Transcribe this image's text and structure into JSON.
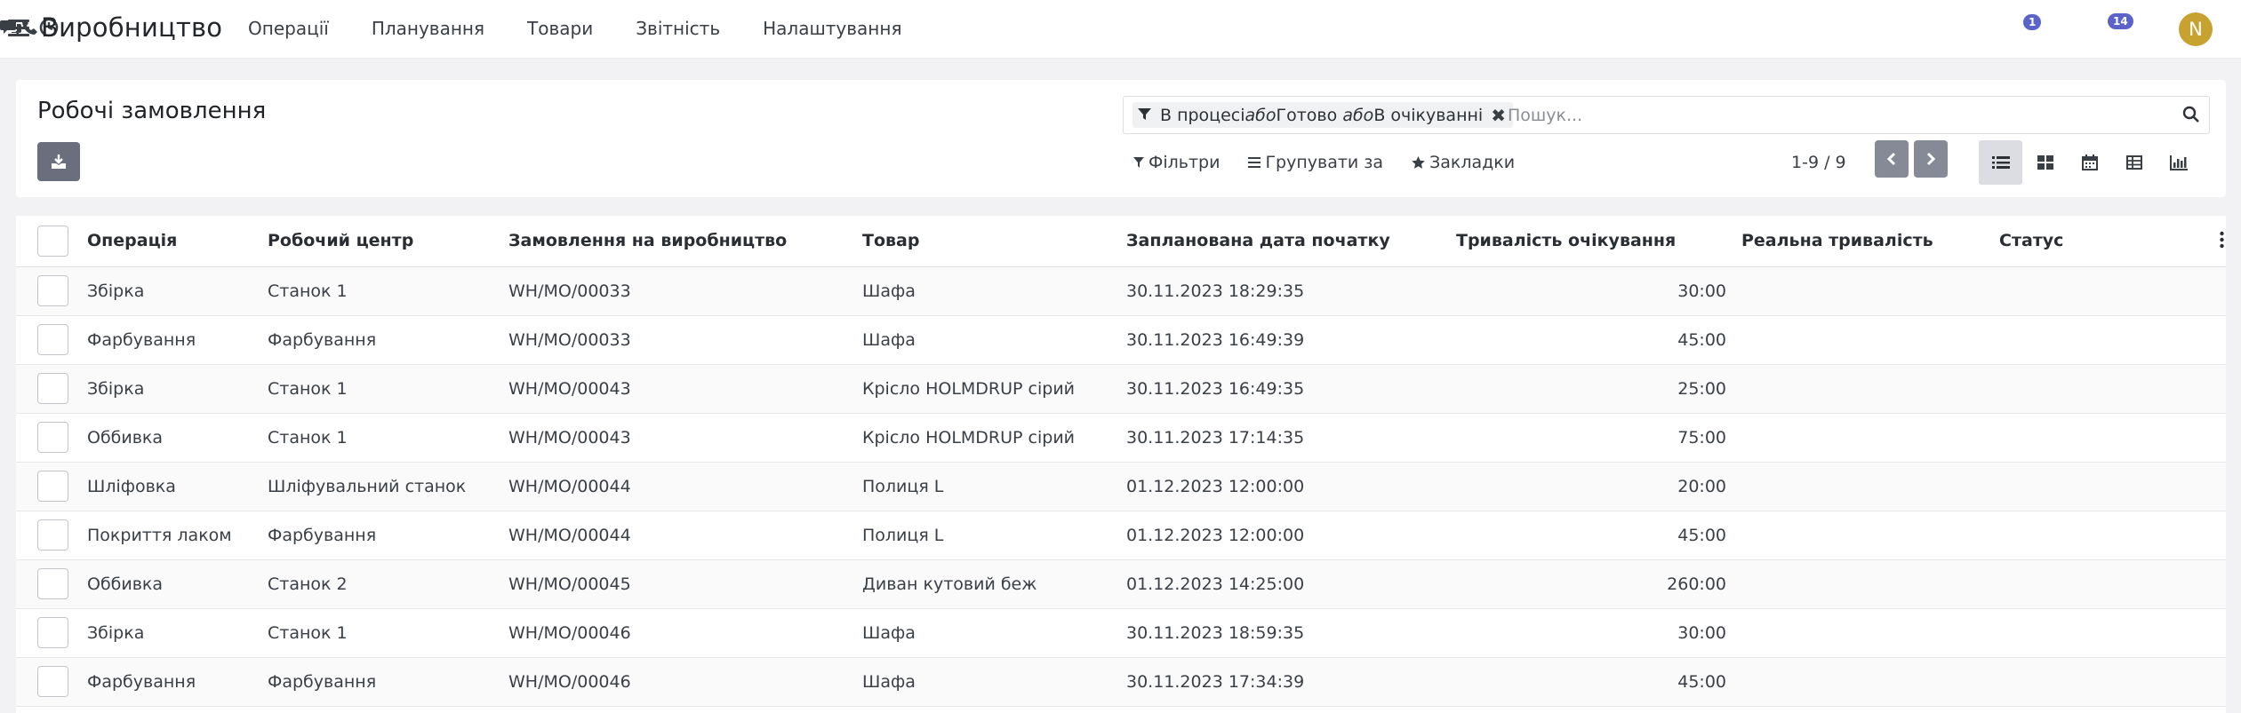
{
  "app": {
    "title": "Виробництво",
    "menu": [
      "Операції",
      "Планування",
      "Товари",
      "Звітність",
      "Налаштування"
    ]
  },
  "systray": {
    "messages_badge": "1",
    "activities_badge": "14",
    "avatar_letter": "N",
    "avatar_color": "#c8a230",
    "accent": "#5b63c9"
  },
  "breadcrumb": "Робочі замовлення",
  "search": {
    "facet_part1": "В процесі ",
    "facet_or1": "або",
    "facet_part2": " Готово ",
    "facet_or2": "або",
    "facet_part3": " В очікуванні",
    "placeholder": "Пошук..."
  },
  "filters": {
    "filters_label": "Фільтри",
    "groupby_label": "Групувати за",
    "favorites_label": "Закладки"
  },
  "pager": {
    "text": "1-9 / 9"
  },
  "table": {
    "headers": [
      "Операція",
      "Робочий центр",
      "Замовлення на виробництво",
      "Товар",
      "Запланована дата початку",
      "Тривалість очікування",
      "Реальна тривалість",
      "Статус"
    ],
    "rows": [
      {
        "op": "Збірка",
        "wc": "Станок 1",
        "mo": "WH/MO/00033",
        "product": "Шафа",
        "date": "30.11.2023 18:29:35",
        "expected": "30:00"
      },
      {
        "op": "Фарбування",
        "wc": "Фарбування",
        "mo": "WH/MO/00033",
        "product": "Шафа",
        "date": "30.11.2023 16:49:39",
        "expected": "45:00"
      },
      {
        "op": "Збірка",
        "wc": "Станок 1",
        "mo": "WH/MO/00043",
        "product": "Крісло HOLMDRUP сірий",
        "date": "30.11.2023 16:49:35",
        "expected": "25:00"
      },
      {
        "op": "Оббивка",
        "wc": "Станок 1",
        "mo": "WH/MO/00043",
        "product": "Крісло HOLMDRUP сірий",
        "date": "30.11.2023 17:14:35",
        "expected": "75:00"
      },
      {
        "op": "Шліфовка",
        "wc": "Шліфувальний станок",
        "mo": "WH/MO/00044",
        "product": "Полиця L",
        "date": "01.12.2023 12:00:00",
        "expected": "20:00"
      },
      {
        "op": "Покриття лаком",
        "wc": "Фарбування",
        "mo": "WH/MO/00044",
        "product": "Полиця L",
        "date": "01.12.2023 12:00:00",
        "expected": "45:00"
      },
      {
        "op": "Оббивка",
        "wc": "Станок 2",
        "mo": "WH/MO/00045",
        "product": "Диван кутовий беж",
        "date": "01.12.2023 14:25:00",
        "expected": "260:00"
      },
      {
        "op": "Збірка",
        "wc": "Станок 1",
        "mo": "WH/MO/00046",
        "product": "Шафа",
        "date": "30.11.2023 18:59:35",
        "expected": "30:00"
      },
      {
        "op": "Фарбування",
        "wc": "Фарбування",
        "mo": "WH/MO/00046",
        "product": "Шафа",
        "date": "30.11.2023 17:34:39",
        "expected": "45:00"
      }
    ]
  }
}
